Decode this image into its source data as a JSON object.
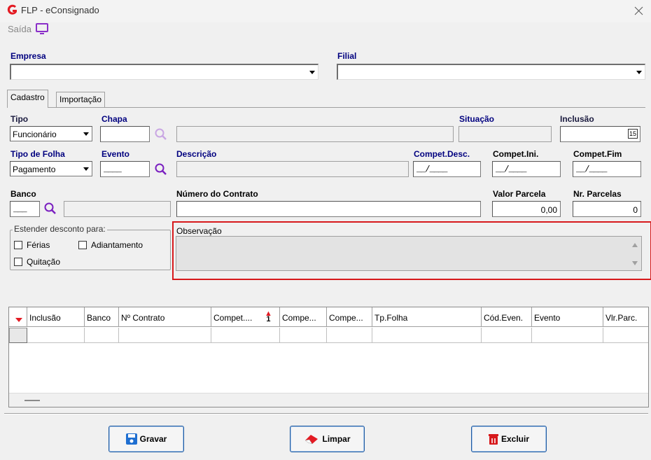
{
  "window": {
    "title": "FLP - eConsignado",
    "menu_saida": "Saída"
  },
  "empresa": {
    "label": "Empresa",
    "value": ""
  },
  "filial": {
    "label": "Filial",
    "value": ""
  },
  "tabs": [
    {
      "label": "Cadastro",
      "active": true
    },
    {
      "label": "Importação",
      "active": false
    }
  ],
  "form": {
    "tipo": {
      "label": "Tipo",
      "value": "Funcionário"
    },
    "chapa": {
      "label": "Chapa",
      "value": ""
    },
    "situacao": {
      "label": "Situação",
      "value": ""
    },
    "inclusao": {
      "label": "Inclusão",
      "value": "",
      "calendar_day": "15"
    },
    "tipo_folha": {
      "label": "Tipo de Folha",
      "value": "Pagamento"
    },
    "evento": {
      "label": "Evento",
      "value": "____"
    },
    "descricao": {
      "label": "Descrição",
      "value": ""
    },
    "compet_desc": {
      "label": "Compet.Desc.",
      "value": "__/____"
    },
    "compet_ini": {
      "label": "Compet.Ini.",
      "value": "__/____"
    },
    "compet_fim": {
      "label": "Compet.Fim",
      "value": "__/____"
    },
    "banco": {
      "label": "Banco",
      "value": "___"
    },
    "numero_contrato": {
      "label": "Número do Contrato",
      "value": ""
    },
    "valor_parcela": {
      "label": "Valor Parcela",
      "value": "0,00"
    },
    "nr_parcelas": {
      "label": "Nr. Parcelas",
      "value": "0"
    },
    "estender": {
      "legend": "Estender desconto para:",
      "ferias": "Férias",
      "adiantamento": "Adiantamento",
      "quitacao": "Quitação"
    },
    "observacao": {
      "label": "Observação",
      "value": ""
    }
  },
  "grid": {
    "columns": [
      "Inclusão",
      "Banco",
      "Nº Contrato",
      "Compet....",
      "Compe...",
      "Compe...",
      "Tp.Folha",
      "Cód.Even.",
      "Evento",
      "Vlr.Parc."
    ],
    "sort_indicator": "1",
    "rows": [
      [
        "",
        "",
        "",
        "",
        "",
        "",
        "",
        "",
        "",
        ""
      ]
    ]
  },
  "buttons": {
    "gravar": "Gravar",
    "limpar": "Limpar",
    "excluir": "Excluir"
  },
  "colors": {
    "accent_red": "#e31b23",
    "label_blue": "#00007f",
    "highlight_red": "#d7191c",
    "purple_icon": "#8b2fc9",
    "button_border": "#1e5aa0"
  }
}
